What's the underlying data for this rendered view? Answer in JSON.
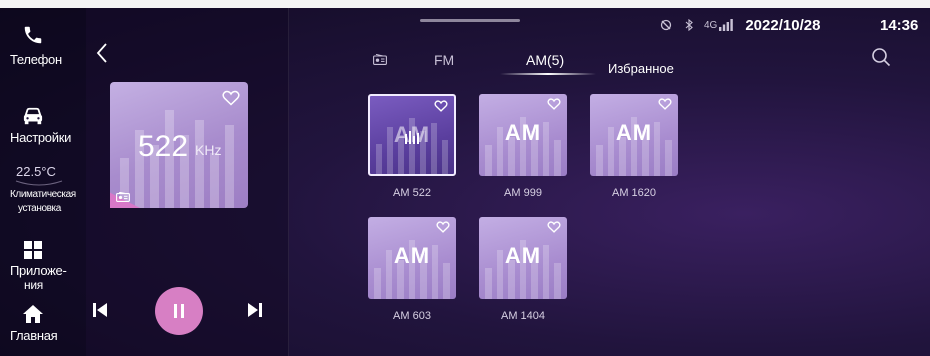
{
  "status_bar": {
    "network": "4G",
    "date": "2022/10/28",
    "time": "14:36"
  },
  "sidebar": {
    "phone_label": "Телефон",
    "settings_label": "Настройки",
    "climate_temp": "22.5°C",
    "climate_label_1": "Климатическая",
    "climate_label_2": "установка",
    "apps_label_1": "Приложе-",
    "apps_label_2": "ния",
    "home_label": "Главная"
  },
  "player": {
    "frequency": "522",
    "unit": "KHz",
    "favorite": true,
    "state": "playing"
  },
  "tabs": {
    "fm": "FM",
    "am": "AM(5)",
    "favorites": "Избранное",
    "active": "am"
  },
  "stations": [
    {
      "logo": "AM",
      "label": "AM 522",
      "active": true,
      "favorite": true
    },
    {
      "logo": "AM",
      "label": "AM 999",
      "active": false,
      "favorite": true
    },
    {
      "logo": "AM",
      "label": "AM 1620",
      "active": false,
      "favorite": true
    },
    {
      "logo": "AM",
      "label": "AM 603",
      "active": false,
      "favorite": true
    },
    {
      "logo": "AM",
      "label": "AM 1404",
      "active": false,
      "favorite": true
    }
  ],
  "colors": {
    "accent_pink": "#d77fc4",
    "card_lilac": "#b39bd8",
    "active_card": "#5b3f9f",
    "background": "#21143d"
  }
}
